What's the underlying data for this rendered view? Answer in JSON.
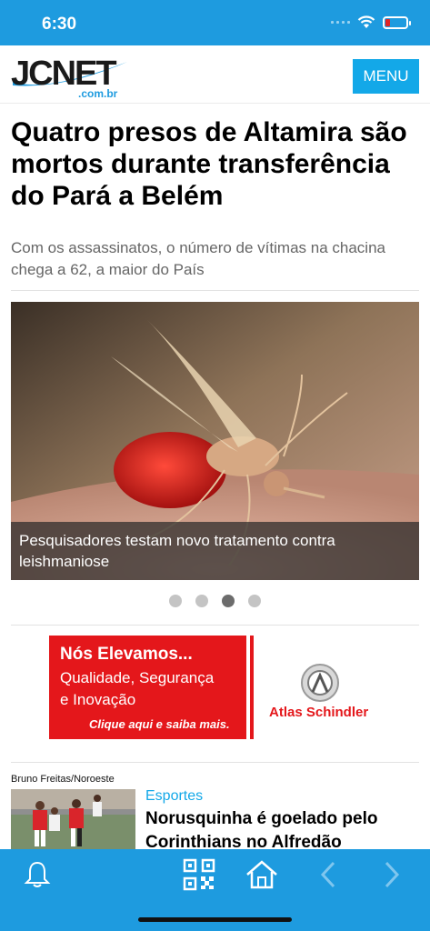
{
  "status_bar": {
    "time": "6:30"
  },
  "header": {
    "logo_text": "JCNET",
    "logo_sub": ".com.br",
    "menu_label": "MENU"
  },
  "main_article": {
    "headline": "Quatro presos de Altamira são mortos durante transferência do Pará a Belém",
    "subhead": "Com os assassinatos, o número de vítimas na chacina chega a 62, a maior do País"
  },
  "carousel": {
    "caption": "Pesquisadores testam novo tratamento contra leishmaniose",
    "slide_count": 4,
    "active_index": 3
  },
  "ad": {
    "title": "Nós Elevamos...",
    "line1": "Qualidade, Segurança",
    "line2": "e Inovação",
    "link": "Clique aqui e saiba mais.",
    "brand": "Atlas Schindler"
  },
  "article_card": {
    "photo_credit": "Bruno Freitas/Noroeste",
    "category": "Esportes",
    "title": "Norusquinha é goelado pelo Corinthians no Alfredão"
  },
  "colors": {
    "primary": "#1e9bdf",
    "menu_button": "#13a8e8",
    "ad_red": "#e4171b",
    "category": "#13a8e8"
  },
  "bottom_nav": {
    "icons": [
      "bell-icon",
      "qr-code-icon",
      "home-icon",
      "chevron-left-icon",
      "chevron-right-icon"
    ]
  }
}
